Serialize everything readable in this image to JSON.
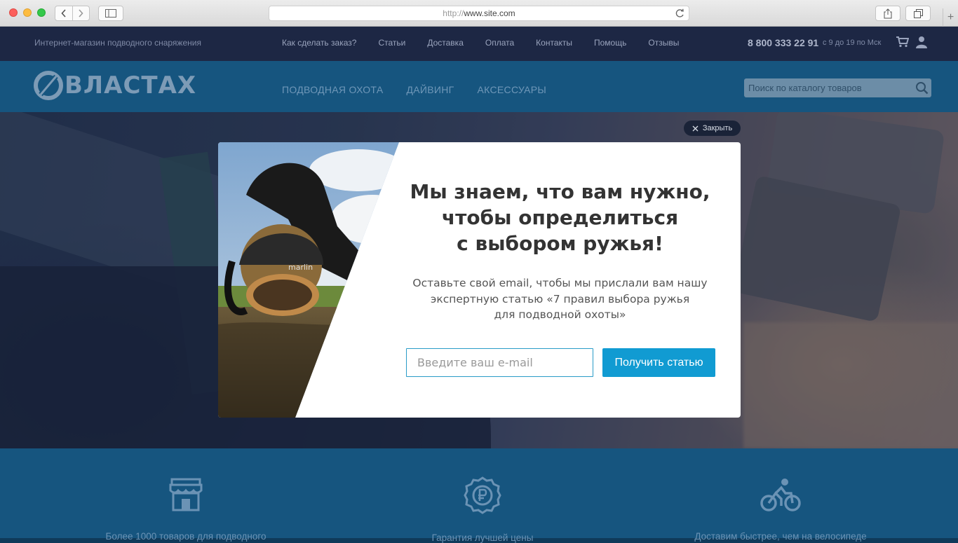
{
  "browser": {
    "url_proto": "http://",
    "url_host": "www.site.com"
  },
  "topbar": {
    "tagline": "Интернет-магазин подводного снаряжения",
    "nav": [
      "Как сделать заказ?",
      "Статьи",
      "Доставка",
      "Оплата",
      "Контакты",
      "Помощь",
      "Отзывы"
    ],
    "phone": "8 800 333 22 91",
    "hours": "с 9 до 19 по Мск"
  },
  "header": {
    "logo": "ВЛАСТАХ",
    "nav": [
      "ПОДВОДНАЯ ОХОТА",
      "ДАЙВИНГ",
      "АКСЕССУАРЫ"
    ],
    "search_placeholder": "Поиск по каталогу товаров"
  },
  "modal": {
    "close_label": "Закрыть",
    "title_lines": [
      "Мы знаем, что вам нужно,",
      "чтобы определиться",
      "с выбором ружья!"
    ],
    "text_lines": [
      "Оставьте свой email, чтобы мы прислали вам нашу",
      "экспертную статью «7 правил выбора ружья",
      "для подводной охоты»"
    ],
    "email_placeholder": "Введите ваш e-mail",
    "submit_label": "Получить статью",
    "mask_brand": "marlin"
  },
  "features": [
    {
      "icon": "store-icon",
      "text": "Более 1000 товаров для подводного"
    },
    {
      "icon": "ruble-badge-icon",
      "text": "Гарантия лучшей цены"
    },
    {
      "icon": "bicycle-icon",
      "text": "Доставим быстрее, чем на велосипеде"
    }
  ],
  "colors": {
    "topbar": "#1d2744",
    "header": "#16557f",
    "accent": "#119bd2"
  }
}
